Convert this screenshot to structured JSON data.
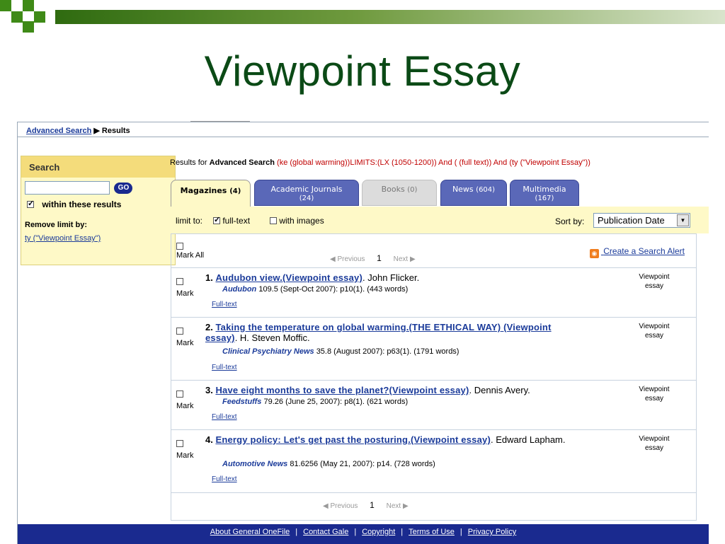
{
  "slide": {
    "title": "Viewpoint Essay"
  },
  "breadcrumb": {
    "link": "Advanced Search",
    "arrow": "▶",
    "current": "Results"
  },
  "sidebar": {
    "heading": "Search",
    "go_label": "GO",
    "within_label": "within these results",
    "remove_heading": "Remove limit by:",
    "remove_link": "ty (\"Viewpoint Essay\")"
  },
  "results_for": {
    "prefix": "Results for",
    "bold": "Advanced Search",
    "query": "(ke (global warming))LIMITS:(LX (1050-1200)) And ( (full text)) And (ty (\"Viewpoint Essay\"))"
  },
  "tabs": [
    {
      "label": "Magazines",
      "count": "(4)"
    },
    {
      "label": "Academic Journals",
      "count": "(24)"
    },
    {
      "label": "Books",
      "count": "(0)"
    },
    {
      "label": "News",
      "count": "(604)"
    },
    {
      "label": "Multimedia",
      "count": "(167)"
    }
  ],
  "limits": {
    "label": "limit to:",
    "fulltext": "full-text",
    "images": "with images",
    "sort_label": "Sort by:",
    "sort_value": "Publication Date"
  },
  "list": {
    "mark_all": "Mark All",
    "previous": "Previous",
    "page": "1",
    "next": "Next",
    "alert": "Create a Search Alert",
    "rss": "rss-feed-icon"
  },
  "results": [
    {
      "num": "1.",
      "title": "Audubon view.(Viewpoint essay)",
      "author": ". John Flicker.",
      "source": "Audubon",
      "citation": "109.5 (Sept-Oct 2007): p10(1). (443 words)",
      "fulltext": "Full-text",
      "doctype": "Viewpoint essay",
      "mark": "Mark"
    },
    {
      "num": "2.",
      "title": "Taking the temperature on global warming.(THE ETHICAL WAY) (Viewpoint essay)",
      "author": ". H. Steven Moffic.",
      "source": "Clinical Psychiatry News",
      "citation": "35.8 (August 2007): p63(1). (1791 words)",
      "fulltext": "Full-text",
      "doctype": "Viewpoint essay",
      "mark": "Mark"
    },
    {
      "num": "3.",
      "title": "Have eight months to save the planet?(Viewpoint essay)",
      "author": ". Dennis Avery.",
      "source": "Feedstuffs",
      "citation": "79.26 (June 25, 2007): p8(1). (621 words)",
      "fulltext": "Full-text",
      "doctype": "Viewpoint essay",
      "mark": "Mark"
    },
    {
      "num": "4.",
      "title": "Energy policy: Let's get past the posturing.(Viewpoint essay)",
      "author": ". Edward Lapham.",
      "source": "Automotive News",
      "citation": "81.6256 (May 21, 2007): p14. (728 words)",
      "fulltext": "Full-text",
      "doctype": "Viewpoint essay",
      "mark": "Mark"
    }
  ],
  "footer": {
    "links": [
      "About General OneFile",
      "Contact Gale",
      "Copyright",
      "Terms of Use",
      "Privacy Policy"
    ]
  },
  "colors": {
    "accent": "#1a2a8f",
    "link": "#1b3b9a",
    "query": "#c00000",
    "panel": "#fef9c7",
    "title": "#0b4a16"
  }
}
